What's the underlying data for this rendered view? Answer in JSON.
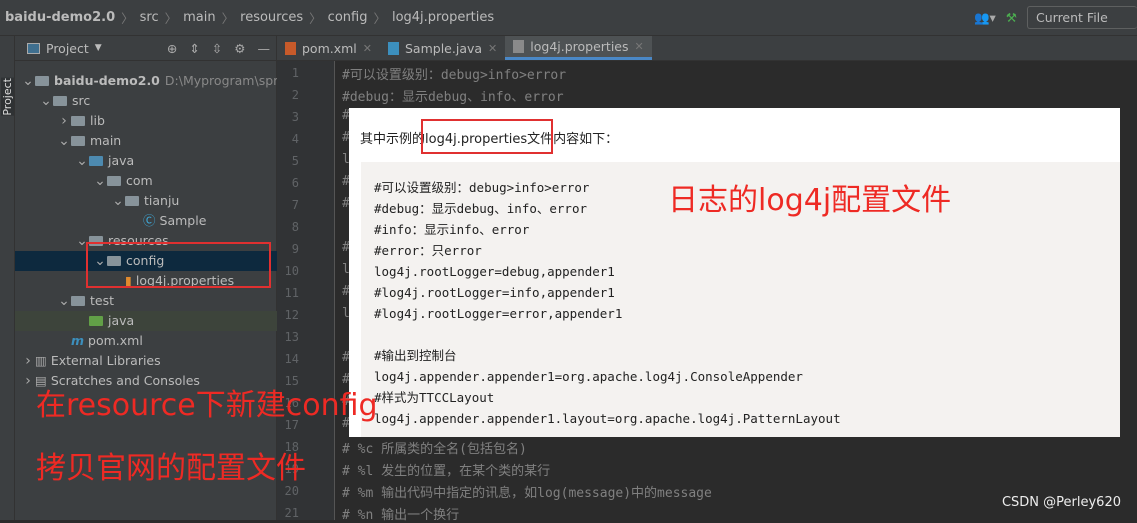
{
  "breadcrumb": [
    "baidu-demo2.0",
    "src",
    "main",
    "resources",
    "config",
    "log4j.properties"
  ],
  "toolbar": {
    "run_config": "Current File"
  },
  "sidebar": {
    "strip_label": "Project",
    "panel_title": "Project",
    "tree": [
      {
        "label": "baidu-demo2.0",
        "path": "D:\\Myprogram\\spring",
        "indent": 0,
        "arrow": "v",
        "icon": "module"
      },
      {
        "label": "src",
        "indent": 1,
        "arrow": "v",
        "icon": "folder"
      },
      {
        "label": "lib",
        "indent": 2,
        "arrow": ">",
        "icon": "folder"
      },
      {
        "label": "main",
        "indent": 2,
        "arrow": "v",
        "icon": "folder"
      },
      {
        "label": "java",
        "indent": 3,
        "arrow": "v",
        "icon": "folder-blue"
      },
      {
        "label": "com",
        "indent": 4,
        "arrow": "v",
        "icon": "folder"
      },
      {
        "label": "tianju",
        "indent": 5,
        "arrow": "v",
        "icon": "folder"
      },
      {
        "label": "Sample",
        "indent": 6,
        "arrow": "",
        "icon": "class"
      },
      {
        "label": "resources",
        "indent": 3,
        "arrow": "v",
        "icon": "folder"
      },
      {
        "label": "config",
        "indent": 4,
        "arrow": "v",
        "icon": "folder"
      },
      {
        "label": "log4j.properties",
        "indent": 5,
        "arrow": "",
        "icon": "properties"
      },
      {
        "label": "test",
        "indent": 2,
        "arrow": "v",
        "icon": "folder"
      },
      {
        "label": "java",
        "indent": 3,
        "arrow": "",
        "icon": "folder-green"
      },
      {
        "label": "pom.xml",
        "indent": 2,
        "arrow": "",
        "icon": "maven"
      },
      {
        "label": "External Libraries",
        "indent": 0,
        "arrow": ">",
        "icon": "libraries"
      },
      {
        "label": "Scratches and Consoles",
        "indent": 0,
        "arrow": ">",
        "icon": "scratches"
      }
    ]
  },
  "tabs": [
    {
      "label": "pom.xml"
    },
    {
      "label": "Sample.java"
    },
    {
      "label": "log4j.properties",
      "active": true
    }
  ],
  "editor": {
    "lines": [
      "#可以设置级别：debug>info>error",
      "#debug：显示debug、info、error",
      "#",
      "#",
      "l",
      "#",
      "#",
      "",
      "#",
      "l",
      "#",
      "l",
      "",
      "#",
      "#",
      "#",
      "#",
      "# %c 所属类的全名(包括包名)",
      "# %l 发生的位置，在某个类的某行",
      "# %m 输出代码中指定的讯息，如log(message)中的message",
      "# %n 输出一个换行"
    ]
  },
  "overlay": {
    "intro": "其中示例的log4j.properties文件内容如下：",
    "lines": [
      "#可以设置级别：debug>info>error",
      "#debug：显示debug、info、error",
      "#info：显示info、error",
      "#error：只error",
      "log4j.rootLogger=debug,appender1",
      "#log4j.rootLogger=info,appender1",
      "#log4j.rootLogger=error,appender1",
      "",
      "#输出到控制台",
      "log4j.appender.appender1=org.apache.log4j.ConsoleAppender",
      "#样式为TTCCLayout",
      "log4j.appender.appender1.layout=org.apache.log4j.PatternLayout"
    ]
  },
  "annotations": {
    "title": "日志的log4j配置文件",
    "step1": "在resource下新建config",
    "step2": "拷贝官网的配置文件"
  },
  "watermark": "CSDN @Perley620",
  "colors": {
    "annotation": "#ee2a24",
    "accent": "#4a88c7"
  }
}
